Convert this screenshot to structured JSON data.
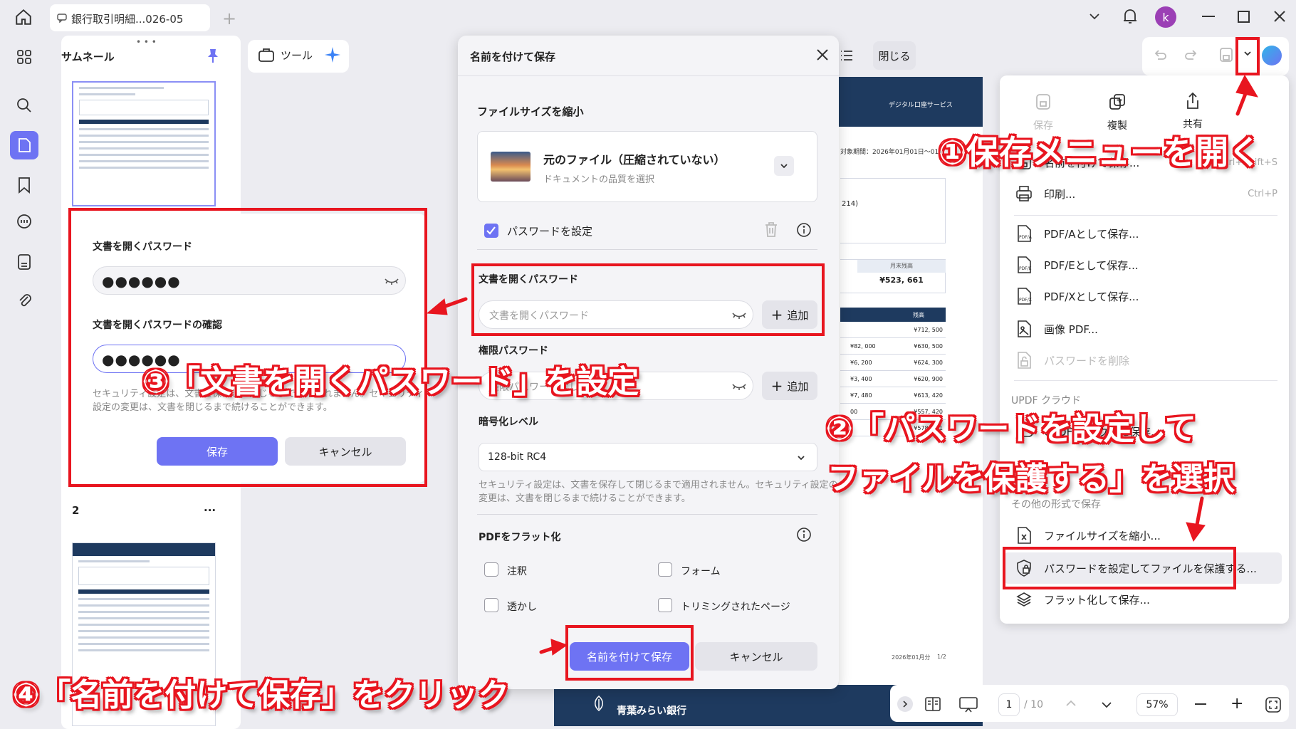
{
  "titlebar": {
    "tab_title": "銀行取引明細...026-05",
    "user_initial": "k"
  },
  "thumbnails": {
    "title": "サムネール",
    "page2_label": "2",
    "page2_menu": "..."
  },
  "toolbar": {
    "tools_label": "ツール",
    "close_label": "閉じる"
  },
  "document": {
    "header_text": "デジタル口座サービス",
    "period": "対象期間：2026年01月01日～01月",
    "box_text": "214)",
    "month_end_label": "月末残高",
    "month_end_value": "¥523, 661",
    "table_header": "残高",
    "rows": [
      {
        "amount": "",
        "balance": "¥712, 500"
      },
      {
        "amount": "¥82, 000",
        "balance": "¥630, 500"
      },
      {
        "amount": "¥6, 200",
        "balance": "¥624, 300"
      },
      {
        "amount": "¥3, 400",
        "balance": "¥620, 900"
      },
      {
        "amount": "¥7, 480",
        "balance": "¥613, 420"
      },
      {
        "amount": "00",
        "balance": "¥557, 420"
      },
      {
        "amount": "",
        "balance": "¥578, 861"
      }
    ],
    "footer_left": "2026年01月分",
    "footer_right": "1/2",
    "bank_name": "青葉みらい銀行"
  },
  "dialog": {
    "title": "名前を付けて保存",
    "reduce_section": "ファイルサイズを縮小",
    "quality_title": "元のファイル（圧縮されていない）",
    "quality_sub": "ドキュメントの品質を選択",
    "password_checkbox": "パスワードを設定",
    "open_pw_label": "文書を開くパスワード",
    "open_pw_placeholder": "文書を開くパスワード",
    "add_label": "追加",
    "perm_pw_label": "権限パスワード",
    "perm_pw_placeholder": "権限パスワードなし",
    "encrypt_label": "暗号化レベル",
    "encrypt_value": "128-bit RC4",
    "note_line1": "セキュリティ設定は、文書を保存して閉じるまで適用されません。セキュリティ設定の",
    "note_line2": "変更は、文書を閉じるまで続けることができます。",
    "flatten_label": "PDFをフラット化",
    "flatten_options": [
      "注釈",
      "フォーム",
      "透かし",
      "トリミングされたページ"
    ],
    "save_as_button": "名前を付けて保存",
    "cancel_button": "キャンセル"
  },
  "password_popup": {
    "label1": "文書を開くパスワード",
    "value1": "●●●●●●",
    "label2": "文書を開くパスワードの確認",
    "value2": "●●●●●●",
    "note_line1": "セキュリティ設定は、文書を保存して閉じるまで適用されません。セキュリティ",
    "note_line2": "設定の変更は、文書を閉じるまで続けることができます。",
    "save_button": "保存",
    "cancel_button": "キャンセル"
  },
  "save_menu": {
    "top_actions": [
      "保存",
      "複製",
      "共有"
    ],
    "save_as_item": "名前を付けて保存...",
    "save_as_shortcut": "Ctrl+Shift+S",
    "print_item": "印刷...",
    "print_shortcut": "Ctrl+P",
    "pdfa_item": "PDF/Aとして保存...",
    "pdfe_item": "PDF/Eとして保存...",
    "pdfx_item": "PDF/Xとして保存...",
    "image_item": "画像 PDF...",
    "remove_pw_item": "パスワードを削除",
    "cloud_section": "UPDF クラウド",
    "cloud_item": "UPDF クラウドに保存...",
    "other_section": "その他の形式で保存",
    "reduce_item": "ファイルサイズを縮小...",
    "protect_item": "パスワードを設定してファイルを保護する...",
    "flatten_item": "フラット化して保存..."
  },
  "bottom_nav": {
    "page_current": "1",
    "page_total": "/ 10",
    "zoom": "57%"
  },
  "callouts": {
    "step1": "①保存メニューを開く",
    "step2_line1": "②「パスワードを設定して",
    "step2_line2": "ファイルを保護する」を選択",
    "step3": "③「文書を開くパスワード」を設定",
    "step4": "④「名前を付けて保存」をクリック"
  },
  "colors": {
    "accent": "#6e73f3",
    "annotation_red": "#e8151f",
    "doc_navy": "#1e3a5f"
  }
}
